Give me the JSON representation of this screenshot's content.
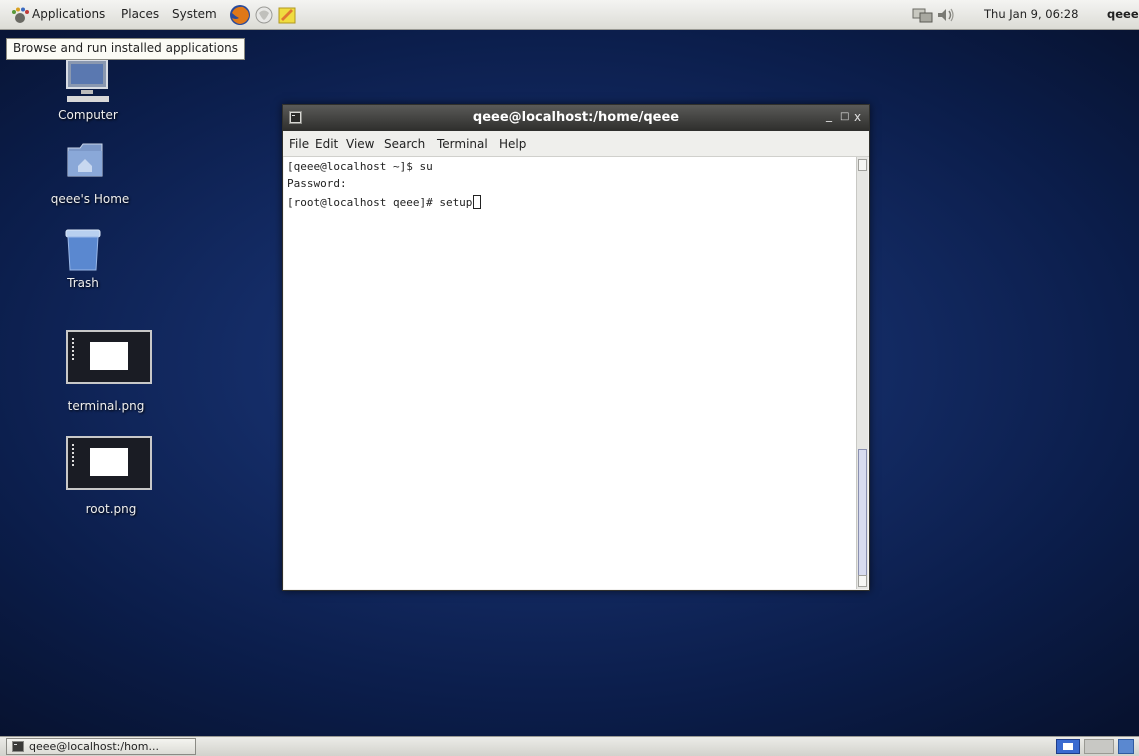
{
  "top_panel": {
    "menus": [
      "Applications",
      "Places",
      "System"
    ],
    "clock": "Thu Jan 9, 06:28",
    "user": "qeee"
  },
  "tooltip": "Browse and run installed applications",
  "desktop": {
    "icons": [
      {
        "label": "Computer"
      },
      {
        "label": "qeee's Home"
      },
      {
        "label": "Trash"
      },
      {
        "label": "terminal.png"
      },
      {
        "label": "root.png"
      }
    ]
  },
  "terminal": {
    "title": "qeee@localhost:/home/qeee",
    "window_buttons": [
      "_",
      "□",
      "x"
    ],
    "menus": [
      "File",
      "Edit",
      "View",
      "Search",
      "Terminal",
      "Help"
    ],
    "lines": [
      "[qeee@localhost ~]$ su",
      "Password:",
      "[root@localhost qeee]# setup"
    ]
  },
  "taskbar": {
    "window_label": "qeee@localhost:/hom..."
  },
  "colors": {
    "desktop_bg": "#142c66",
    "panel_bg": "#e6e6e2",
    "titlebar_bg": "#3a3a38"
  }
}
